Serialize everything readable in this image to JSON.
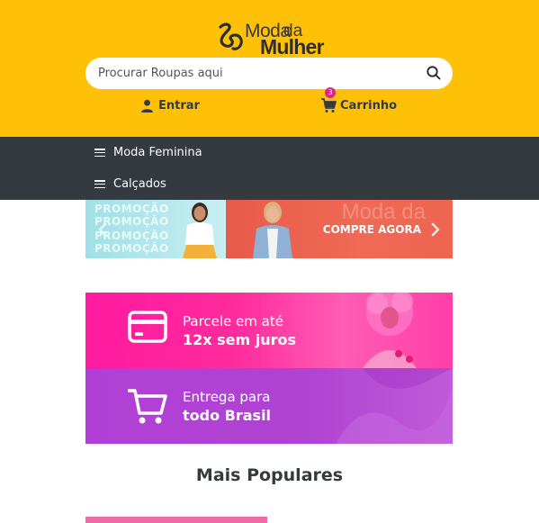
{
  "header": {
    "logo": {
      "word1": "Moda",
      "word2": "da",
      "word3": "Mulher"
    },
    "search": {
      "placeholder": "Procurar Roupas aqui"
    },
    "account_label": "Entrar",
    "cart": {
      "label": "Carrinho",
      "count": "3"
    },
    "background_color": "#ffc107"
  },
  "nav": {
    "items": [
      {
        "label": "Moda Feminina"
      },
      {
        "label": "Calçados"
      }
    ],
    "background_color": "#343a40"
  },
  "carousel": {
    "promo_lines": [
      "PROMOÇÃO",
      "PROMOÇÃO",
      "PROMOÇÃO",
      "PROMOÇÃO"
    ],
    "cta": "COMPRE AGORA",
    "watermark": "Moda da"
  },
  "benefits": [
    {
      "line1": "Parcele em até",
      "line2": "12x sem juros",
      "icon": "credit-card-icon",
      "color": "#ff1aa0"
    },
    {
      "line1": "Entrega para",
      "line2": "todo Brasil",
      "icon": "shopping-cart-icon",
      "color": "#b13fd6"
    }
  ],
  "section": {
    "title": "Mais Populares"
  }
}
